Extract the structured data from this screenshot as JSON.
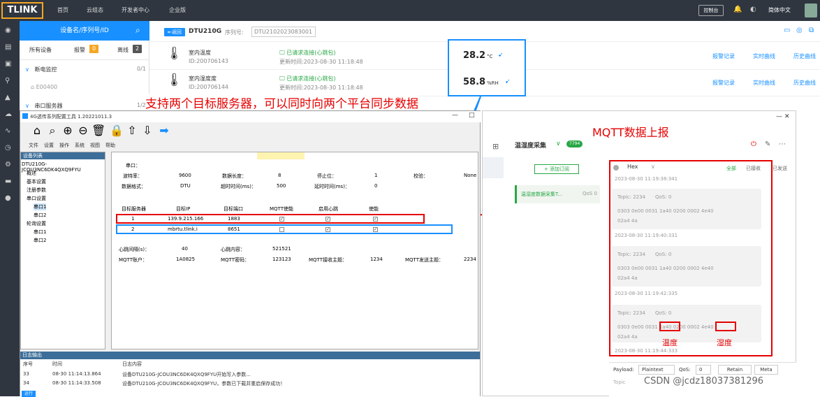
{
  "topbar": {
    "logo": "TLINK",
    "nav": [
      "首页",
      "云组态",
      "开发者中心",
      "企业版"
    ],
    "console": "控制台",
    "lang": "简体中文"
  },
  "sidebar": {
    "search_placeholder": "设备名/序列号/ID",
    "tabs": {
      "all": "所有设备",
      "alarm": "报警",
      "alarm_count": "0",
      "offline": "离线",
      "offline_count": "2"
    },
    "groups": [
      {
        "label": "断电监控",
        "count": "0/1"
      },
      {
        "label": "E00400"
      },
      {
        "label": "串口服务器",
        "count": "1/2"
      }
    ]
  },
  "device": {
    "back": "返回",
    "name": "DTU210G",
    "serial_label": "序列号:",
    "serial": "DTU2102023083001",
    "sensors": [
      {
        "name": "室内温度",
        "id": "ID:200706143",
        "status": "已请求连接(心跳包)",
        "time": "更新时间:2023-08-30 11:18:48",
        "value": "28.2",
        "unit": "°C"
      },
      {
        "name": "室内湿度度",
        "id": "ID:200706144",
        "status": "已请求连接(心跳包)",
        "time": "更新时间:2023-08-30 11:18:48",
        "value": "58.8",
        "unit": "%RH"
      }
    ],
    "actions": [
      "报警记录",
      "实时曲线",
      "历史曲线"
    ]
  },
  "annotations": {
    "main": "支持两个目标服务器，可以同时向两个平台同步数据",
    "mqtt": "MQTT数据上报",
    "temp": "温度",
    "humid": "湿度",
    "watermark": "CSDN @jcdz18037381296"
  },
  "tool": {
    "title": "4G透传系列配置工具 1.20221011.3",
    "menu": [
      "文件",
      "设置",
      "操作",
      "系统",
      "视图",
      "帮助"
    ],
    "tree_header": "设备列表",
    "tree": [
      "DTU210G-JCOU3NC6DK4QXQ9FYU",
      "概述",
      "基本设置",
      "注册参数",
      "串口设置",
      "串口1",
      "串口2",
      "轮询设置",
      "串口1",
      "串口2"
    ],
    "grid": {
      "port_label": "串口：",
      "r1": [
        "波特率：",
        "9600",
        "数据长度：",
        "8",
        "停止位：",
        "1",
        "校验：",
        "None"
      ],
      "r2": [
        "数据格式：",
        "DTU",
        "超时时间(ms)：",
        "500",
        "延时时间(ms)：",
        "0"
      ],
      "headers": [
        "目标服务器",
        "目标IP",
        "目标端口",
        "MQTT使能",
        "启用心跳",
        "使能"
      ],
      "servers": [
        {
          "no": "1",
          "ip": "139.9.215.166",
          "port": "1883"
        },
        {
          "no": "2",
          "ip": "mbrtu.tlink.i",
          "port": "8651"
        }
      ],
      "heartbeat_label": "心跳间隔(s)：",
      "heartbeat": "40",
      "heart_content_label": "心跳内容：",
      "heart_content": "521521",
      "mqtt_account_label": "MQTT账户：",
      "mqtt_account": "1A0825",
      "mqtt_pwd_label": "MQTT密码：",
      "mqtt_pwd": "123123",
      "mqtt_sub_label": "MQTT接收主题：",
      "mqtt_sub": "1234",
      "mqtt_pub_label": "MQTT发送主题：",
      "mqtt_pub": "2234"
    },
    "log": {
      "header": "日志输出",
      "cols": [
        "序号",
        "时间",
        "日志内容"
      ],
      "rows": [
        {
          "no": "33",
          "time": "08-30 11:14:13.864",
          "msg": "设备DTU210G-JCOU3NC6DK4QXQ9FYU开始写入参数..."
        },
        {
          "no": "34",
          "time": "08-30 11:14:33.508",
          "msg": "设备DTU210G-JCOU3NC6DK4QXQ9FYU，参数已下载并重启保存成功！"
        }
      ],
      "status": "运行"
    }
  },
  "mqttx": {
    "conn": "温湿度采集",
    "conn_badge": "7794",
    "add_sub": "+ 添加订阅",
    "sub_topic": "温湿度数据采集T...",
    "sub_qos": "QoS 0",
    "format": "Hex",
    "filters": [
      "全部",
      "已接收",
      "已发送"
    ],
    "messages": [
      {
        "topic": "Topic: 2234",
        "qos": "QoS: 0",
        "payload1": "0303 0e00 0031 1a40 0200 0002 4e40",
        "payload2": "02a4 4a",
        "time": "2023-08-30 11:19:40:331"
      },
      {
        "topic": "Topic: 2234",
        "qos": "QoS: 0",
        "payload1": "0303 0e00 0031 1a40 0200 0002 4e40",
        "payload2": "02a4 4a",
        "time": "2023-08-30 11:19:42:335"
      },
      {
        "topic": "Topic: 2234",
        "qos": "QoS: 0",
        "payload1": "0303 0e00 0031 1a40 0200 0002 4e40",
        "payload2": "02a4 4a",
        "time": "2023-08-30 11:19:44:333"
      }
    ],
    "prev_time": "2023-08-30 11:19:38:341",
    "payload_label": "Payload:",
    "payload_type": "Plaintext",
    "qos_label": "QoS:",
    "qos": "0",
    "retain": "Retain",
    "meta": "Meta",
    "topic_placeholder": "Topic"
  },
  "colors": {
    "accent": "#1890ff",
    "highlight": "#e60000",
    "topbar": "#2f3640"
  }
}
